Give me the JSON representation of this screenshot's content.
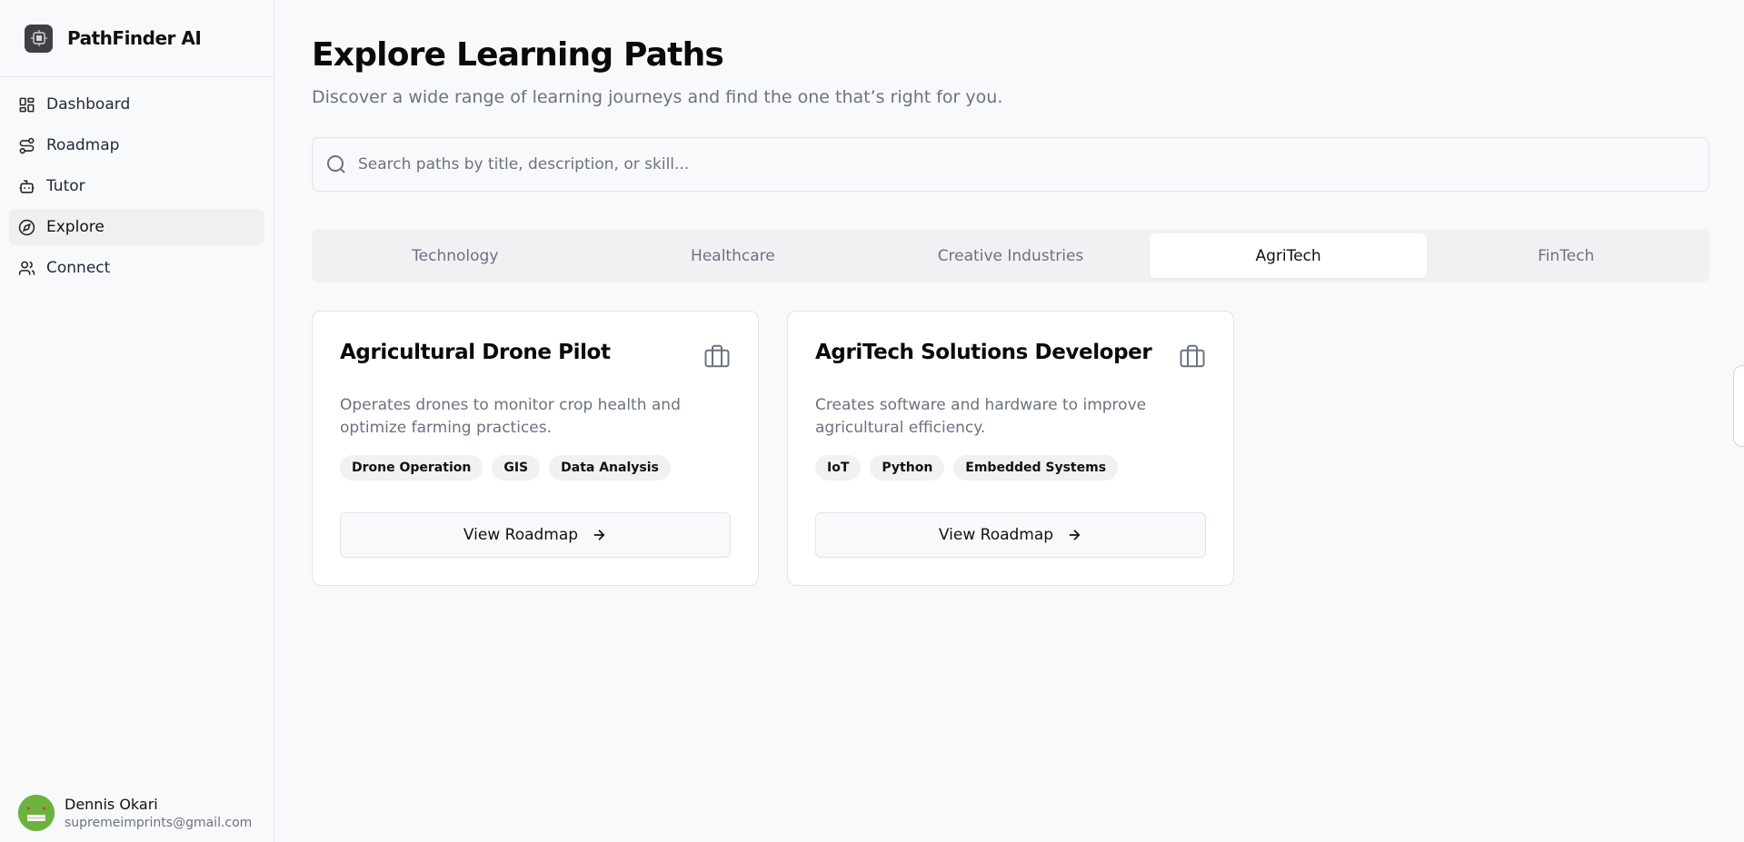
{
  "app": {
    "name": "PathFinder AI"
  },
  "sidebar": {
    "items": [
      {
        "label": "Dashboard",
        "icon": "dashboard-icon"
      },
      {
        "label": "Roadmap",
        "icon": "roadmap-icon"
      },
      {
        "label": "Tutor",
        "icon": "bot-icon"
      },
      {
        "label": "Explore",
        "icon": "compass-icon",
        "active": true
      },
      {
        "label": "Connect",
        "icon": "users-icon"
      }
    ],
    "user": {
      "name": "Dennis Okari",
      "email": "supremeimprints@gmail.com"
    }
  },
  "main": {
    "title": "Explore Learning Paths",
    "subtitle": "Discover a wide range of learning journeys and find the one that’s right for you.",
    "search": {
      "placeholder": "Search paths by title, description, or skill..."
    },
    "tabs": [
      {
        "label": "Technology"
      },
      {
        "label": "Healthcare"
      },
      {
        "label": "Creative Industries"
      },
      {
        "label": "AgriTech",
        "active": true
      },
      {
        "label": "FinTech"
      }
    ],
    "cards": [
      {
        "title": "Agricultural Drone Pilot",
        "description": "Operates drones to monitor crop health and optimize farming practices.",
        "tags": [
          "Drone Operation",
          "GIS",
          "Data Analysis"
        ],
        "button_label": "View Roadmap"
      },
      {
        "title": "AgriTech Solutions Developer",
        "description": "Creates software and hardware to improve agricultural efficiency.",
        "tags": [
          "IoT",
          "Python",
          "Embedded Systems"
        ],
        "button_label": "View Roadmap"
      }
    ]
  },
  "colors": {
    "background": "#f8f9fb",
    "avatar": "#6cb33e",
    "text": "#111827",
    "muted": "#6b7280"
  }
}
